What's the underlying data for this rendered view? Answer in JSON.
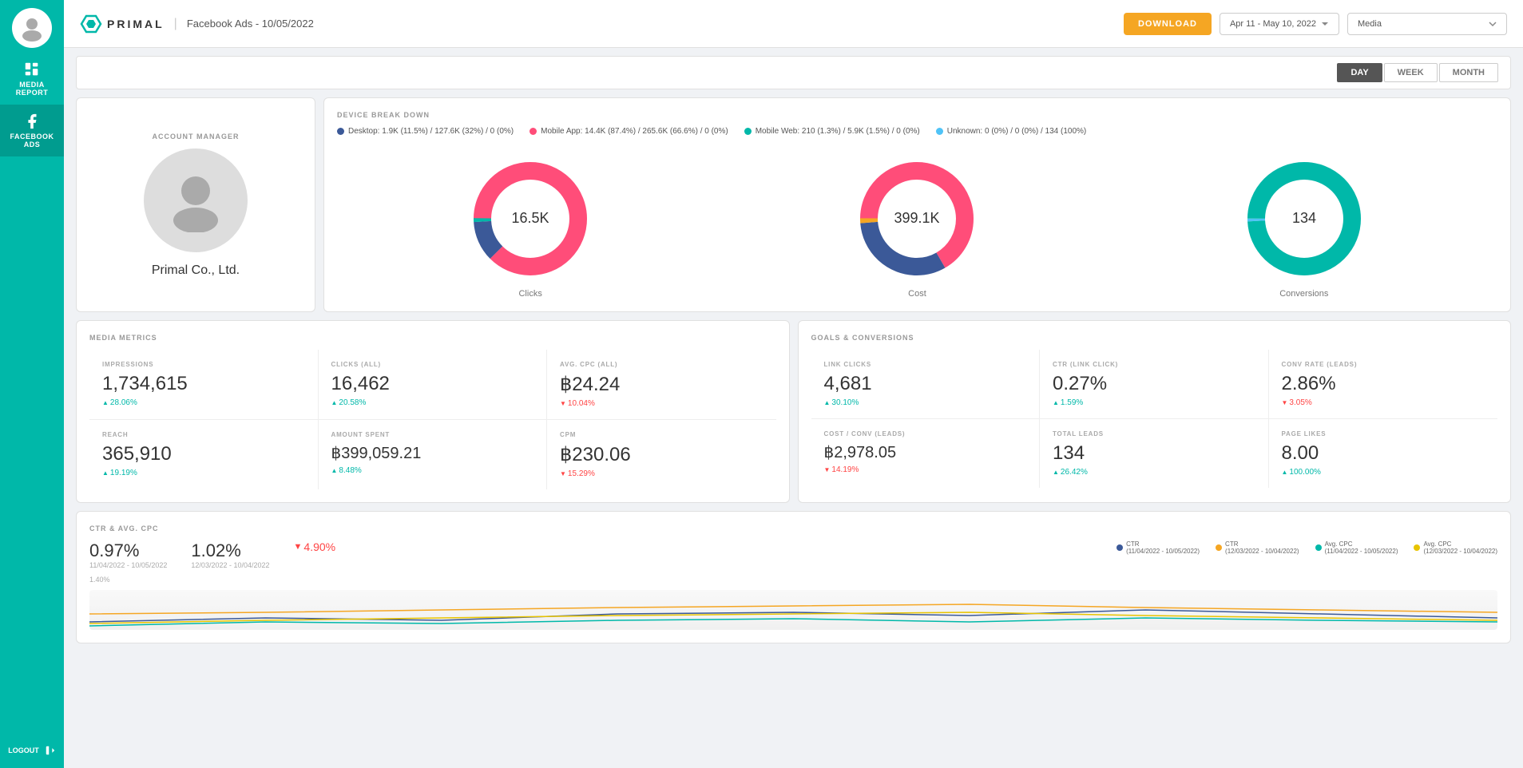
{
  "sidebar": {
    "nav_items": [
      {
        "id": "media-report",
        "label": "MEDIA\nREPORT",
        "active": false
      },
      {
        "id": "facebook-ads",
        "label": "FACEBOOK\nADS",
        "active": true
      }
    ],
    "logout_label": "LOGOUT"
  },
  "topbar": {
    "logo_text": "PRIMAL",
    "page_title": "Facebook Ads - 10/05/2022",
    "download_label": "DOWNLOAD",
    "date_range": "Apr 11 - May 10, 2022",
    "media_placeholder": "Media"
  },
  "period_tabs": {
    "tabs": [
      "DAY",
      "WEEK",
      "MONTH"
    ],
    "active": "DAY"
  },
  "account": {
    "section_label": "ACCOUNT MANAGER",
    "name": "Primal Co., Ltd."
  },
  "device_breakdown": {
    "section_label": "DEVICE BREAK DOWN",
    "legend": [
      {
        "color": "#3b5998",
        "text": "Desktop: 1.9K (11.5%) / 127.6K (32%) / 0 (0%)"
      },
      {
        "color": "#00b8a9",
        "text": "Mobile Web: 210 (1.3%) / 5.9K (1.5%) / 0 (0%)"
      },
      {
        "color": "#ff4d79",
        "text": "Mobile App: 14.4K (87.4%) / 265.6K (66.6%) / 0 (0%)"
      },
      {
        "color": "#4fc3f7",
        "text": "Unknown: 0 (0%) / 0 (0%) / 134 (100%)"
      }
    ],
    "charts": [
      {
        "id": "clicks",
        "label": "Clicks",
        "value": "16.5K",
        "segments": [
          {
            "color": "#ff4d79",
            "pct": 87.4
          },
          {
            "color": "#3b5998",
            "pct": 11.5
          },
          {
            "color": "#00b8a9",
            "pct": 1.1
          }
        ]
      },
      {
        "id": "cost",
        "label": "Cost",
        "value": "399.1K",
        "segments": [
          {
            "color": "#ff4d79",
            "pct": 66.6
          },
          {
            "color": "#3b5998",
            "pct": 32
          },
          {
            "color": "#f5a623",
            "pct": 1.4
          }
        ]
      },
      {
        "id": "conversions",
        "label": "Conversions",
        "value": "134",
        "segments": [
          {
            "color": "#00b8a9",
            "pct": 100
          }
        ]
      }
    ]
  },
  "media_metrics": {
    "section_label": "MEDIA METRICS",
    "metrics": [
      {
        "key": "IMPRESSIONS",
        "value": "1,734,615",
        "change": "+28.06%",
        "up": true
      },
      {
        "key": "CLICKS (ALL)",
        "value": "16,462",
        "change": "+20.58%",
        "up": true
      },
      {
        "key": "AVG. CPC (ALL)",
        "value": "฿24.24",
        "change": "-10.04%",
        "up": false
      },
      {
        "key": "REACH",
        "value": "365,910",
        "change": "+19.19%",
        "up": true
      },
      {
        "key": "AMOUNT SPENT",
        "value": "฿399,059.21",
        "change": "+8.48%",
        "up": true
      },
      {
        "key": "CPM",
        "value": "฿230.06",
        "change": "-15.29%",
        "up": false
      }
    ]
  },
  "goals_conversions": {
    "section_label": "GOALS & CONVERSIONS",
    "metrics": [
      {
        "key": "LINK CLICKS",
        "value": "4,681",
        "change": "+30.10%",
        "up": true
      },
      {
        "key": "CTR (LINK CLICK)",
        "value": "0.27%",
        "change": "+1.59%",
        "up": true
      },
      {
        "key": "CONV RATE (LEADS)",
        "value": "2.86%",
        "change": "-3.05%",
        "up": false
      },
      {
        "key": "COST / CONV (LEADS)",
        "value": "฿2,978.05",
        "change": "-14.19%",
        "up": false
      },
      {
        "key": "TOTAL LEADS",
        "value": "134",
        "change": "+26.42%",
        "up": true
      },
      {
        "key": "PAGE LIKES",
        "value": "8.00",
        "change": "+100.00%",
        "up": true
      }
    ]
  },
  "ctr_section": {
    "section_label": "CTR & AVG. CPC",
    "values": [
      {
        "val": "0.97%",
        "date": "11/04/2022 - 10/05/2022",
        "change": null,
        "up": null
      },
      {
        "val": "1.02%",
        "date": "12/03/2022 - 10/04/2022",
        "change": null,
        "up": null
      },
      {
        "val": "▼ 4.90%",
        "date": "",
        "change": "-4.90%",
        "up": false
      }
    ],
    "legend": [
      {
        "color": "#3b5998",
        "label": "CTR\n(11/04/2022 - 10/05/2022)"
      },
      {
        "color": "#f5a623",
        "label": "CTR\n(12/03/2022 - 10/04/2022)"
      },
      {
        "color": "#00b8a9",
        "label": "Avg. CPC\n(11/04/2022 - 10/05/2022)"
      },
      {
        "color": "#e8c400",
        "label": "Avg. CPC\n(12/03/2022 - 10/04/2022)"
      }
    ]
  }
}
